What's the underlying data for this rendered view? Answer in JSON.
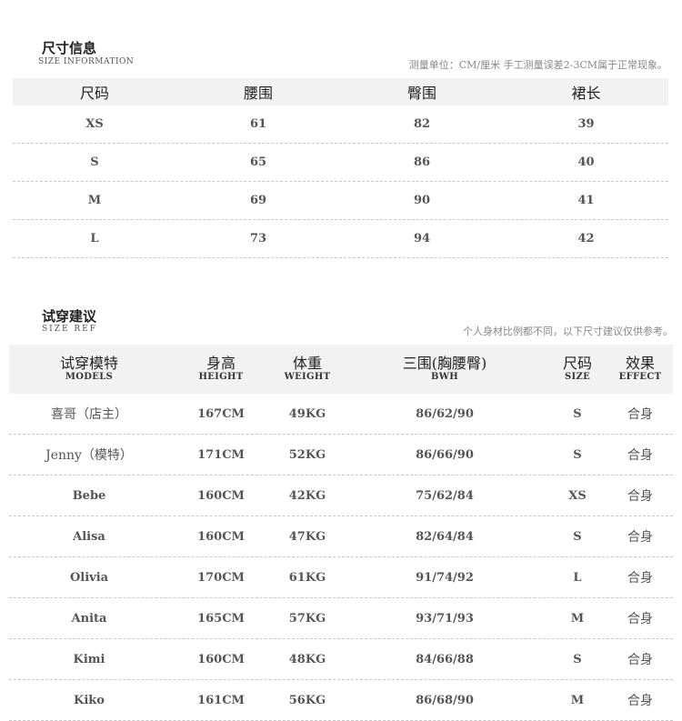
{
  "size_info": {
    "title_cn": "尺寸信息",
    "title_en": "SIZE INFORMATION",
    "note": "测量单位：CM/厘米  手工测量误差2-3CM属于正常现象。",
    "headers": [
      "尺码",
      "腰围",
      "臀围",
      "裙长"
    ],
    "rows": [
      [
        "XS",
        "61",
        "82",
        "39"
      ],
      [
        "S",
        "65",
        "86",
        "40"
      ],
      [
        "M",
        "69",
        "90",
        "41"
      ],
      [
        "L",
        "73",
        "94",
        "42"
      ]
    ]
  },
  "fit_ref": {
    "title_cn": "试穿建议",
    "title_en": "SIZE  REF",
    "note": "个人身材比例都不同，以下尺寸建议仅供参考。",
    "headers": [
      {
        "cn": "试穿模特",
        "en": "MODELS"
      },
      {
        "cn": "身高",
        "en": "HEIGHT"
      },
      {
        "cn": "体重",
        "en": "WEIGHT"
      },
      {
        "cn": "三围(胸腰臀)",
        "en": "BWH"
      },
      {
        "cn": "尺码",
        "en": "SIZE"
      },
      {
        "cn": "效果",
        "en": "EFFECT"
      }
    ],
    "rows": [
      [
        "喜哥（店主）",
        "167CM",
        "49KG",
        "86/62/90",
        "S",
        "合身"
      ],
      [
        "Jenny（模特）",
        "171CM",
        "52KG",
        "86/66/90",
        "S",
        "合身"
      ],
      [
        "Bebe",
        "160CM",
        "42KG",
        "75/62/84",
        "XS",
        "合身"
      ],
      [
        "Alisa",
        "160CM",
        "47KG",
        "82/64/84",
        "S",
        "合身"
      ],
      [
        "Olivia",
        "170CM",
        "61KG",
        "91/74/92",
        "L",
        "合身"
      ],
      [
        "Anita",
        "165CM",
        "57KG",
        "93/71/93",
        "M",
        "合身"
      ],
      [
        "Kimi",
        "160CM",
        "48KG",
        "84/66/88",
        "S",
        "合身"
      ],
      [
        "Kiko",
        "161CM",
        "56KG",
        "86/68/90",
        "M",
        "合身"
      ]
    ]
  }
}
